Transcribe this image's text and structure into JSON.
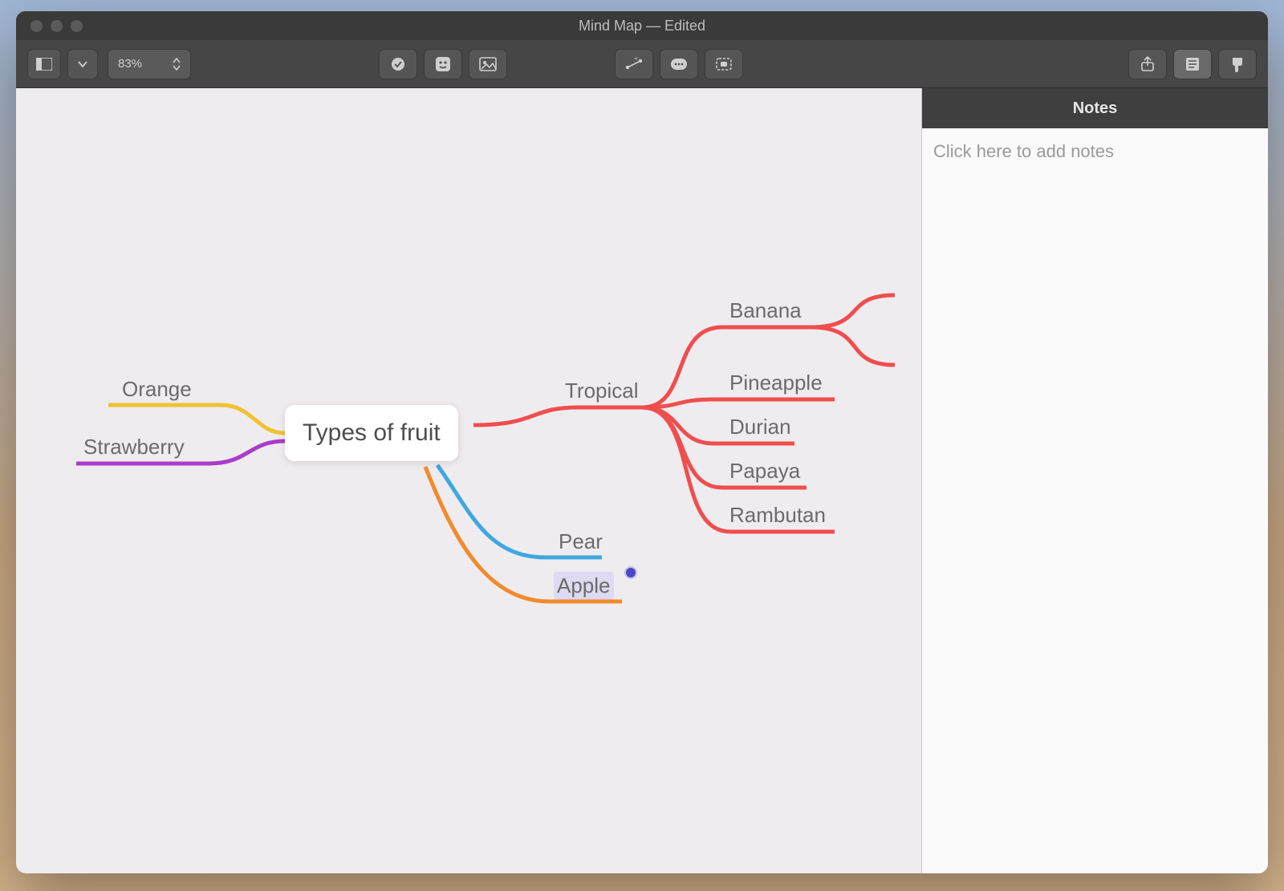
{
  "window": {
    "title": "Mind Map — Edited"
  },
  "toolbar": {
    "zoom_label": "83%"
  },
  "sidebar": {
    "title": "Notes",
    "placeholder": "Click here to add notes"
  },
  "colors": {
    "red": "#ef4e4e",
    "yellow": "#f1c232",
    "purple": "#aa3cc9",
    "blue": "#3fa7e0",
    "orange": "#f28a2e"
  },
  "mindmap": {
    "central": {
      "label": "Types of fruit"
    },
    "left": [
      {
        "id": "orange",
        "label": "Orange",
        "color_key": "yellow"
      },
      {
        "id": "strawberry",
        "label": "Strawberry",
        "color_key": "purple"
      }
    ],
    "right": [
      {
        "id": "tropical",
        "label": "Tropical",
        "color_key": "red",
        "children": [
          {
            "id": "banana",
            "label": "Banana"
          },
          {
            "id": "pineapple",
            "label": "Pineapple"
          },
          {
            "id": "durian",
            "label": "Durian"
          },
          {
            "id": "papaya",
            "label": "Papaya"
          },
          {
            "id": "rambutan",
            "label": "Rambutan"
          }
        ]
      },
      {
        "id": "pear",
        "label": "Pear",
        "color_key": "blue"
      },
      {
        "id": "apple",
        "label": "Apple",
        "color_key": "orange",
        "selected": true,
        "has_note": true
      }
    ]
  }
}
